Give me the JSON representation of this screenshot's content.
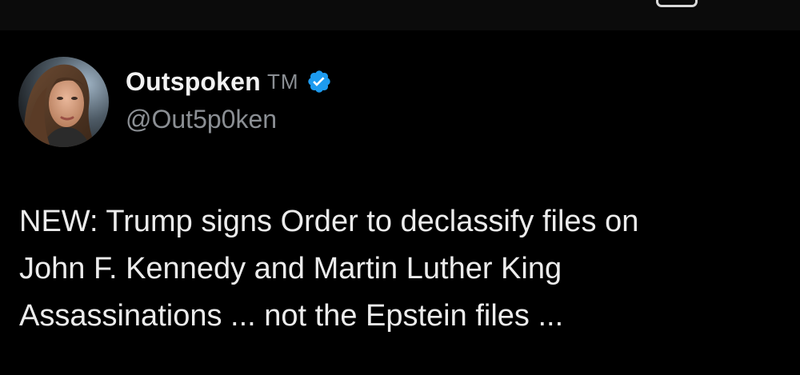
{
  "post": {
    "author": {
      "display_name": "Outspoken",
      "name_suffix": "TM",
      "handle": "@Out5p0ken",
      "verified": true,
      "verified_icon": "verified-badge-icon",
      "avatar_icon": "profile-photo-avatar"
    },
    "text": "NEW: Trump signs Order to declassify files on\nJohn F. Kennedy and Martin Luther King\nAssassinations ... not the Epstein files ..."
  },
  "colors": {
    "background": "#000000",
    "top_bar": "#0b0b0b",
    "primary_text": "#e7e9ea",
    "secondary_text": "#8b8f94",
    "verified_blue": "#1d9bf0"
  },
  "top_bar": {
    "icon": "bookmark-tab-icon"
  }
}
